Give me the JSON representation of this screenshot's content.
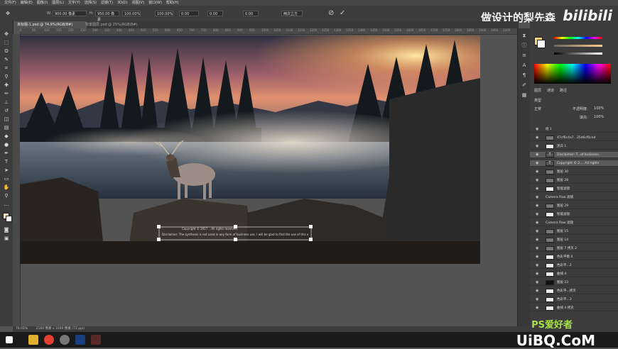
{
  "menubar": {
    "items": [
      "文件(F)",
      "编辑(E)",
      "图像(I)",
      "图层(L)",
      "文字(Y)",
      "选择(S)",
      "滤镜(T)",
      "3D(D)",
      "视图(V)",
      "窗口(W)",
      "帮助(H)"
    ]
  },
  "options": {
    "w_label": "W:",
    "w_value": "900.00 像素",
    "h_label": "H:",
    "h_value": "950.00 像素",
    "scale_w": "100.00%",
    "scale_h": "100.00%",
    "angle": "0.00",
    "h_skew": "0.00",
    "v_skew": "0.00",
    "interp": "两次立方"
  },
  "watermark": {
    "text": "做设计的梨先森",
    "logo": "bilibili"
  },
  "tabs": [
    {
      "label": "未标题-1.psd @ 74.9%(RGB/8#)"
    },
    {
      "label": "背景图层.psd @ 25%(RGB/8#)"
    }
  ],
  "ruler": {
    "ticks": [
      "0",
      "50",
      "100",
      "150",
      "200",
      "250",
      "300",
      "350",
      "400",
      "450",
      "500",
      "550",
      "600",
      "650",
      "700",
      "750",
      "800",
      "850",
      "900",
      "950",
      "1000",
      "1050",
      "1100",
      "1150",
      "1200",
      "1250",
      "1300",
      "1350",
      "1400",
      "1450",
      "1500",
      "1550",
      "1600",
      "1650",
      "1700",
      "1750",
      "1800",
      "1850",
      "1900",
      "1950",
      "2000"
    ]
  },
  "canvas": {
    "copyright_text": "Copyright © 2017 ...All rights reserved",
    "disclaimer_text": "Disclaimer: The synthesis is not used in any form of business use. I will be glad to find the use of this work"
  },
  "panels": {
    "color_tabs": [
      "颜色",
      "色板"
    ],
    "layer_tabs": [
      "图层",
      "通道",
      "路径"
    ],
    "kind_label": "类型",
    "mode_label": "正常",
    "opacity_label": "不透明度:",
    "opacity_value": "100%",
    "fill_label": "填充:",
    "fill_value": "100%",
    "layers": [
      {
        "name": "组 1",
        "thumb": "none",
        "sel": false
      },
      {
        "name": "47cf6c4a7...35d6cf0ced",
        "thumb": "gray",
        "sel": false
      },
      {
        "name": "黑白 1",
        "thumb": "white",
        "sel": false
      },
      {
        "name": "Disclaimer: T...of business,",
        "thumb": "text",
        "sel": true
      },
      {
        "name": "Copyright © 2.... All rights",
        "thumb": "text",
        "sel": true
      },
      {
        "name": "图层 30",
        "thumb": "gray",
        "sel": false
      },
      {
        "name": "图层 28",
        "thumb": "gray",
        "sel": false
      },
      {
        "name": "智能滤镜",
        "thumb": "white",
        "sel": false
      },
      {
        "name": "Camera Raw 滤镜",
        "thumb": "none",
        "sel": false
      },
      {
        "name": "图层 29",
        "thumb": "gray",
        "sel": false
      },
      {
        "name": "智能滤镜",
        "thumb": "white",
        "sel": false
      },
      {
        "name": "Camera Raw 滤镜",
        "thumb": "none",
        "sel": false
      },
      {
        "name": "图层 15",
        "thumb": "gray",
        "sel": false
      },
      {
        "name": "图层 14",
        "thumb": "gray",
        "sel": false
      },
      {
        "name": "图层 7 拷贝 2",
        "thumb": "gray",
        "sel": false
      },
      {
        "name": "色彩平衡 4",
        "thumb": "white",
        "sel": false
      },
      {
        "name": "色彩平...2",
        "thumb": "white",
        "sel": false
      },
      {
        "name": "曲线 4",
        "thumb": "white",
        "sel": false
      },
      {
        "name": "图层 23",
        "thumb": "black",
        "sel": false
      },
      {
        "name": "色彩平...拷贝",
        "thumb": "white",
        "sel": false
      },
      {
        "name": "色彩平...3",
        "thumb": "white",
        "sel": false
      },
      {
        "name": "曲线 4 拷贝",
        "thumb": "white",
        "sel": false
      }
    ]
  },
  "statusbar": {
    "zoom": "74.91%",
    "doc": "2160 像素 x 1040 像素 (72 ppi)"
  },
  "overlay": {
    "site": "UiBQ.CoM",
    "ps": "PS爱好者"
  },
  "colors": {
    "accent": "#ffd27a",
    "sel": "#5b5b5b"
  }
}
